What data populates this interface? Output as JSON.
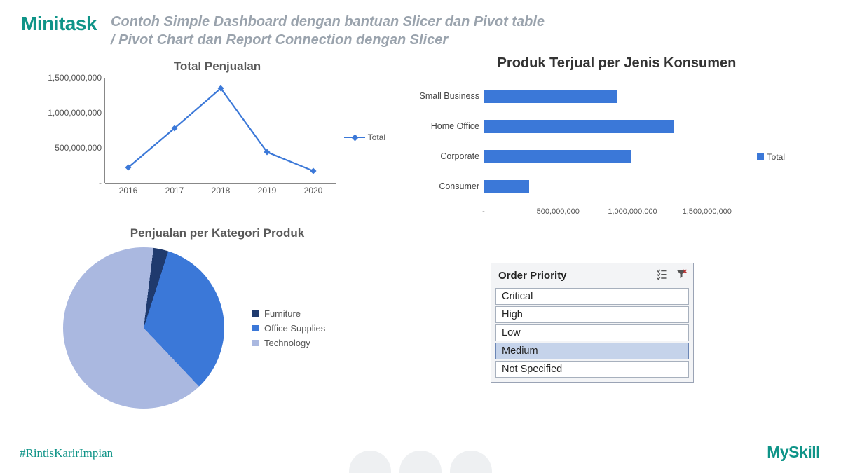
{
  "header": {
    "brand": "Minitask",
    "subtitle": "Contoh Simple Dashboard dengan bantuan Slicer dan Pivot table / Pivot Chart dan Report Connection dengan Slicer"
  },
  "footer": {
    "hashtag": "#RintisKarirImpian",
    "brand": "MySkill"
  },
  "slicer": {
    "title": "Order Priority",
    "items": [
      "Critical",
      "High",
      "Low",
      "Medium",
      "Not Specified"
    ],
    "selected": "Medium"
  },
  "chart_data": [
    {
      "id": "line",
      "type": "line",
      "title": "Total Penjualan",
      "x": [
        "2016",
        "2017",
        "2018",
        "2019",
        "2020"
      ],
      "series": [
        {
          "name": "Total",
          "values": [
            220000000,
            780000000,
            1350000000,
            440000000,
            170000000
          ]
        }
      ],
      "yticks": [
        0,
        500000000,
        1000000000,
        1500000000
      ],
      "ytick_labels": [
        "-",
        "500,000,000",
        "1,000,000,000",
        "1,500,000,000"
      ],
      "ylim": [
        0,
        1500000000
      ],
      "legend": "Total"
    },
    {
      "id": "bar",
      "type": "bar",
      "orientation": "horizontal",
      "title": "Produk Terjual per Jenis Konsumen",
      "categories": [
        "Small Business",
        "Home Office",
        "Corporate",
        "Consumer"
      ],
      "series": [
        {
          "name": "Total",
          "values": [
            890000000,
            1280000000,
            990000000,
            300000000
          ]
        }
      ],
      "xticks": [
        0,
        500000000,
        1000000000,
        1500000000
      ],
      "xtick_labels": [
        "-",
        "500,000,000",
        "1,000,000,000",
        "1,500,000,000"
      ],
      "xlim": [
        0,
        1600000000
      ],
      "legend": "Total"
    },
    {
      "id": "pie",
      "type": "pie",
      "title": "Penjualan per Kategori Produk",
      "categories": [
        "Furniture",
        "Office Supplies",
        "Technology"
      ],
      "values": [
        3,
        33,
        64
      ],
      "colors": [
        "#1f3a6e",
        "#3b78d8",
        "#aab8e0"
      ]
    }
  ]
}
